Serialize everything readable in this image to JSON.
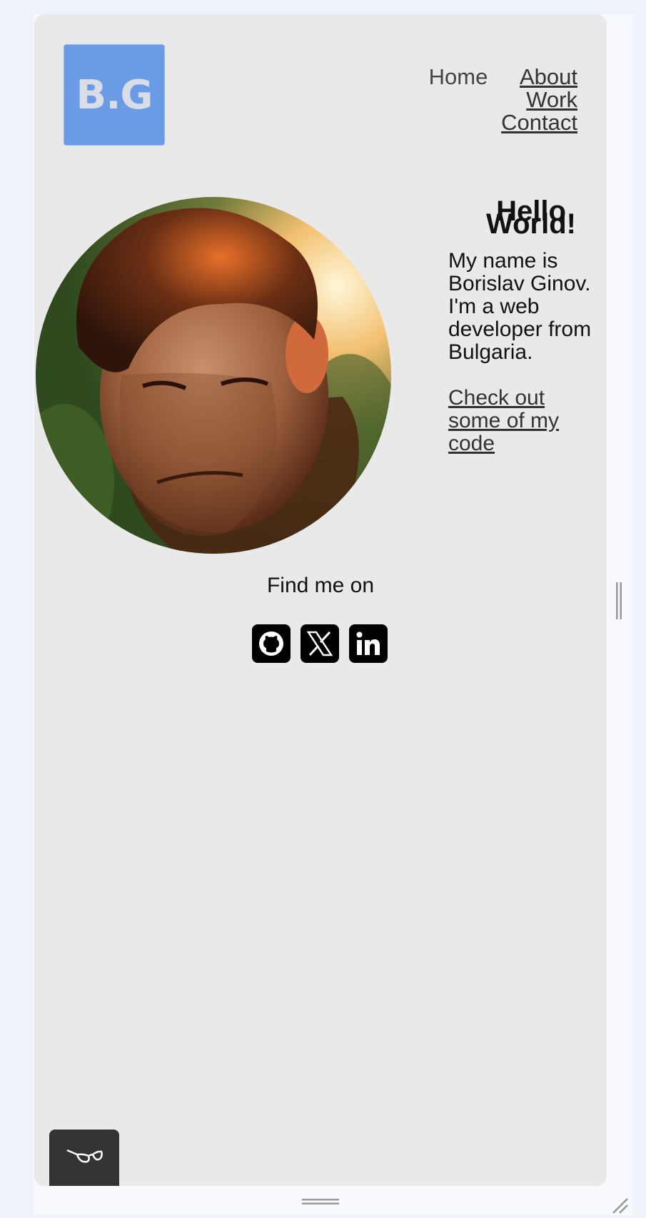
{
  "logo": {
    "text": "B.G",
    "color": "#6a9ce6"
  },
  "nav": {
    "items": [
      {
        "label": "Home"
      },
      {
        "label": "About"
      },
      {
        "label": "Work"
      },
      {
        "label": "Contact"
      }
    ]
  },
  "hero": {
    "heading_line1": "Hello",
    "heading_line2": "World!",
    "intro": "My name is Borislav Ginov. I'm a web developer from Bulgaria.",
    "code_link": "Check out some of my code"
  },
  "social": {
    "heading": "Find me on",
    "icons": [
      "github-icon",
      "x-icon",
      "linkedin-icon"
    ]
  },
  "colors": {
    "page_background": "#e9e9e9",
    "text": "#111111",
    "link": "#333333",
    "accessibility_button": "#333333"
  }
}
